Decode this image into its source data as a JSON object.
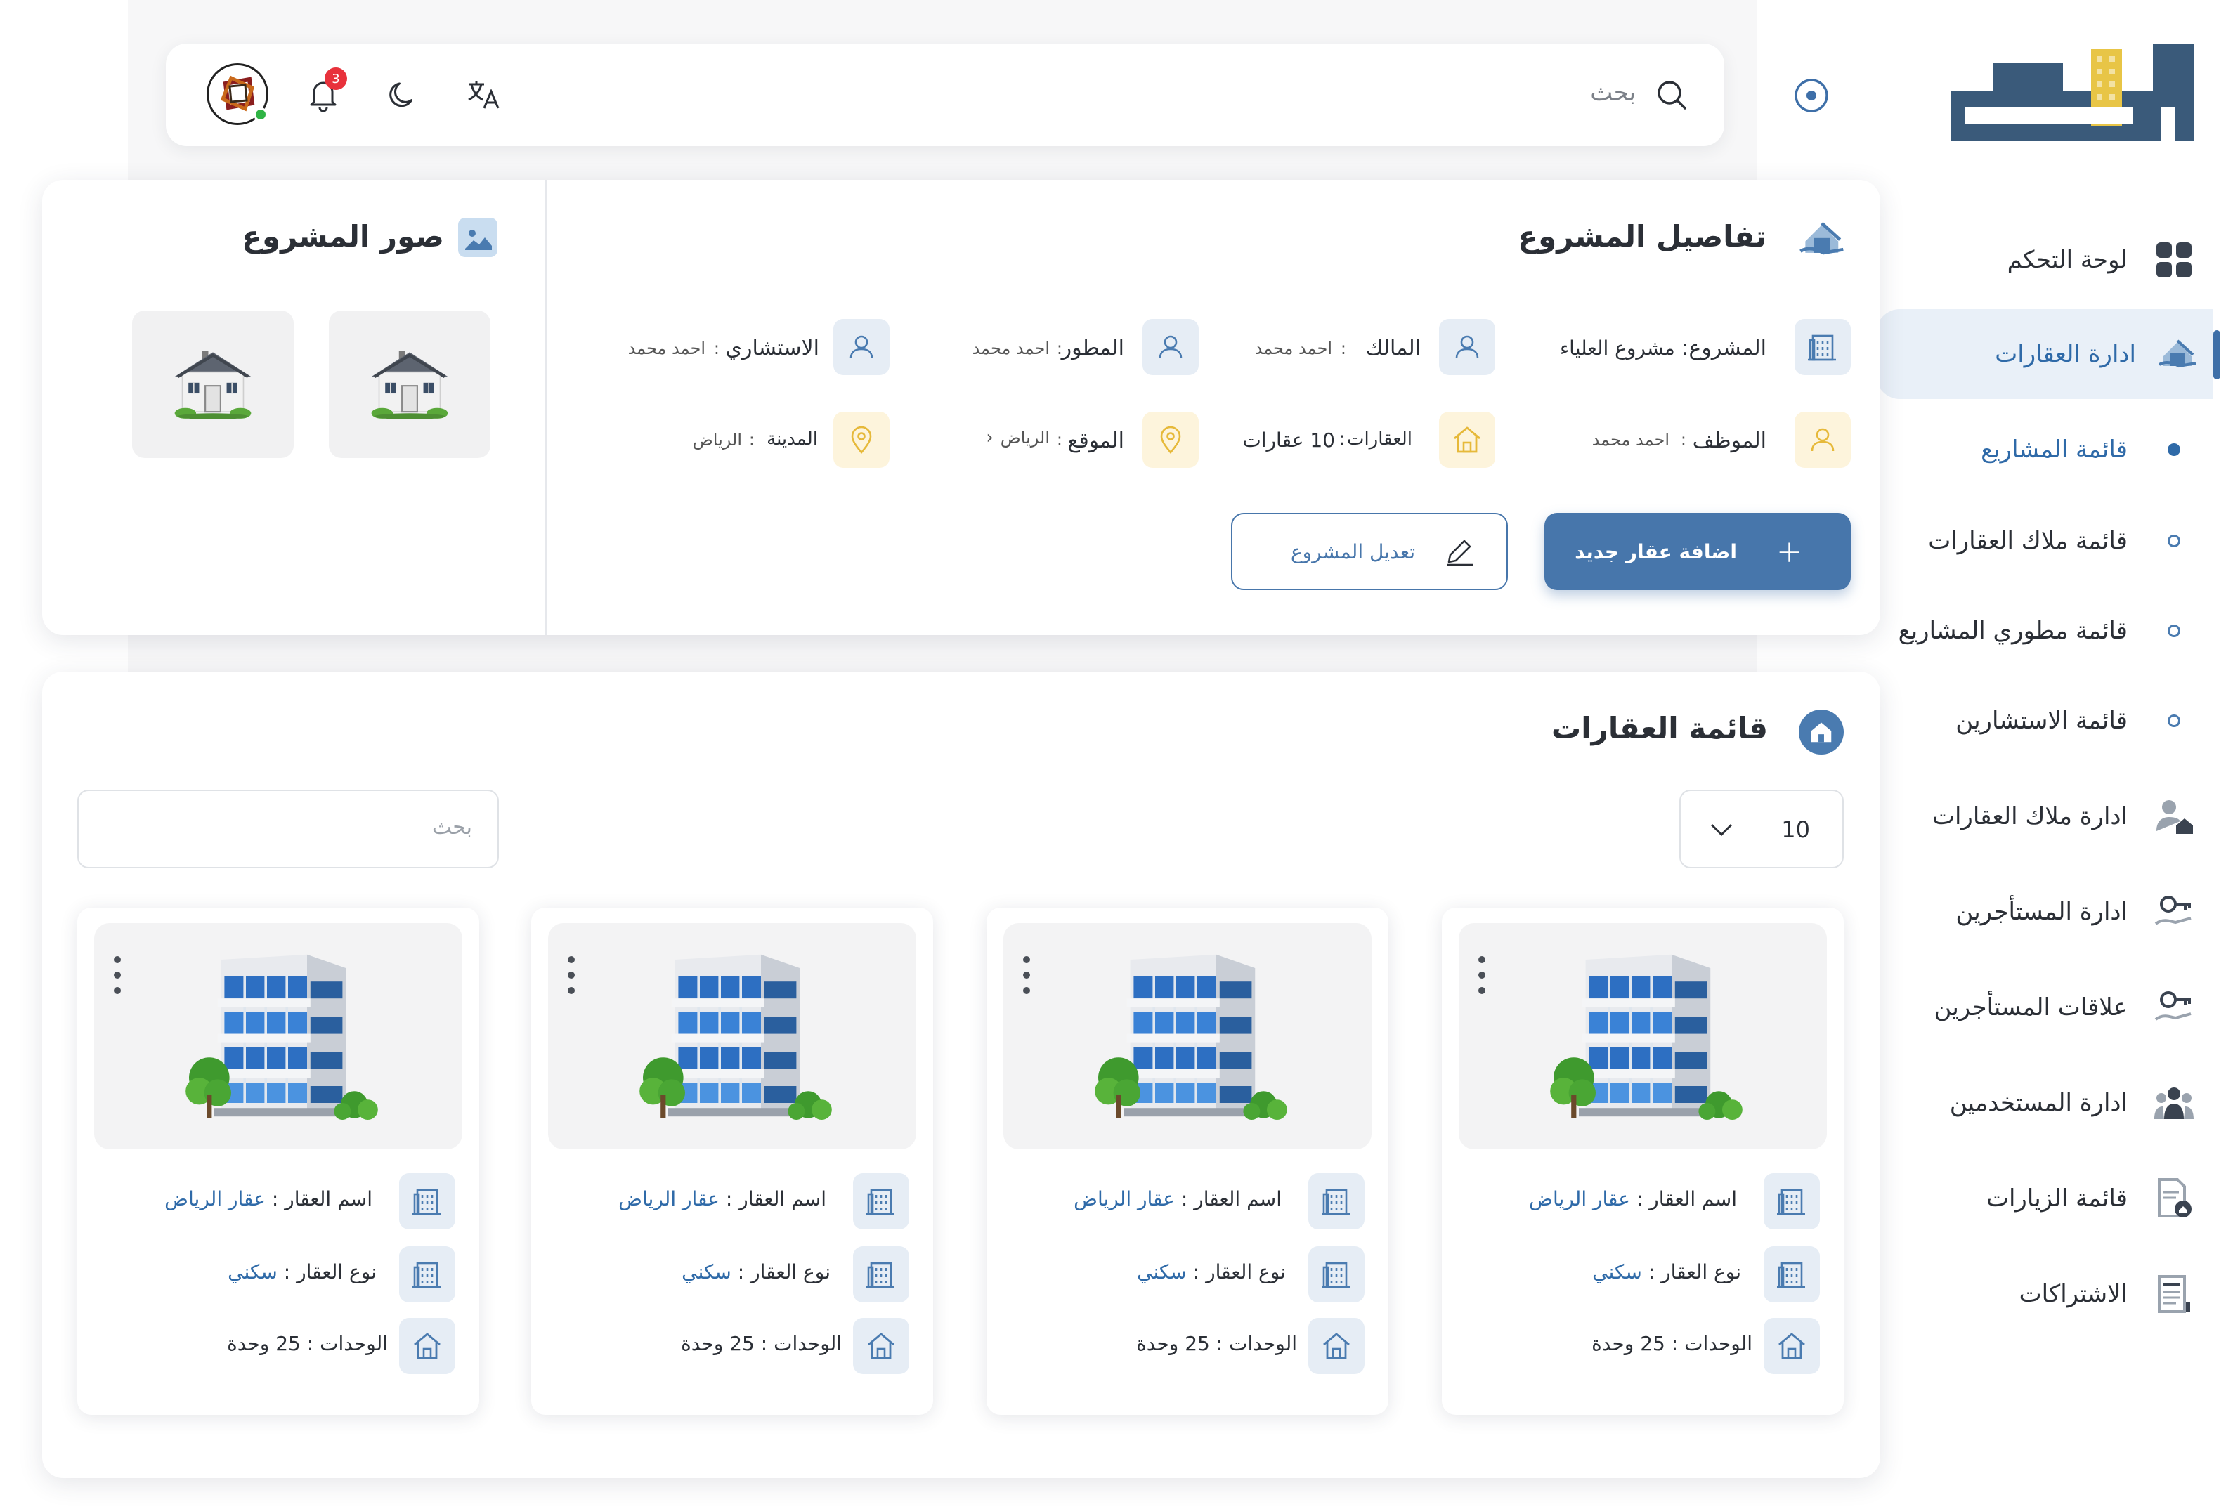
{
  "topbar": {
    "search_placeholder": "بحث",
    "notification_count": "3"
  },
  "brand": {
    "logo_text": "املاك",
    "accent": "#e8c546",
    "primary": "#3a5a7a"
  },
  "sidebar": {
    "items": [
      {
        "label": "لوحة التحكم",
        "icon": "dashboard-grid-icon"
      },
      {
        "label": "ادارة العقارات",
        "icon": "buildings-hand-icon"
      },
      {
        "label": "قائمة المشاريع",
        "icon": "dot"
      },
      {
        "label": "قائمة ملاك العقارات",
        "icon": "circle"
      },
      {
        "label": "قائمة مطوري المشاريع",
        "icon": "circle"
      },
      {
        "label": "قائمة الاستشارين",
        "icon": "circle"
      },
      {
        "label": "ادارة ملاك العقارات",
        "icon": "owner-house-icon"
      },
      {
        "label": "ادارة المستأجرين",
        "icon": "key-hand-icon"
      },
      {
        "label": "علاقات المستأجرين",
        "icon": "key-hand-icon"
      },
      {
        "label": "ادارة المستخدمين",
        "icon": "users-icon"
      },
      {
        "label": "قائمة الزيارات",
        "icon": "document-house-icon"
      },
      {
        "label": "الاشتراكات",
        "icon": "subscription-icon"
      }
    ]
  },
  "project": {
    "title": "تفاصيل المشروع",
    "fields": {
      "project_label": "المشروع",
      "project_value": "مشروع العلياء",
      "owner_label": "المالك",
      "owner_value": "احمد محمد",
      "developer_label": "المطور",
      "developer_value": "احمد محمد",
      "consultant_label": "الاستشاري",
      "consultant_value": "احمد محمد",
      "employee_label": "الموظف",
      "employee_value": "احمد محمد",
      "properties_label": "العقارات",
      "properties_value": "10 عقارات",
      "location_label": "الموقع",
      "location_value": "الرياض",
      "city_label": "المدينة",
      "city_value": "الرياض"
    },
    "add_button": "اضافة عقار جديد",
    "edit_button": "تعديل المشروع",
    "photos_title": "صور المشروع"
  },
  "properties": {
    "title": "قائمة العقارات",
    "page_size": "10",
    "search_placeholder": "بحث",
    "cards": [
      {
        "name_label": "اسم العقار :",
        "name": "عقار الرياض",
        "type_label": "نوع العقار :",
        "type": "سكني",
        "units": "الوحدات : 25 وحدة"
      },
      {
        "name_label": "اسم العقار :",
        "name": "عقار الرياض",
        "type_label": "نوع العقار :",
        "type": "سكني",
        "units": "الوحدات : 25 وحدة"
      },
      {
        "name_label": "اسم العقار :",
        "name": "عقار الرياض",
        "type_label": "نوع العقار :",
        "type": "سكني",
        "units": "الوحدات : 25 وحدة"
      },
      {
        "name_label": "اسم العقار :",
        "name": "عقار الرياض",
        "type_label": "نوع العقار :",
        "type": "سكني",
        "units": "الوحدات : 25 وحدة"
      }
    ]
  }
}
